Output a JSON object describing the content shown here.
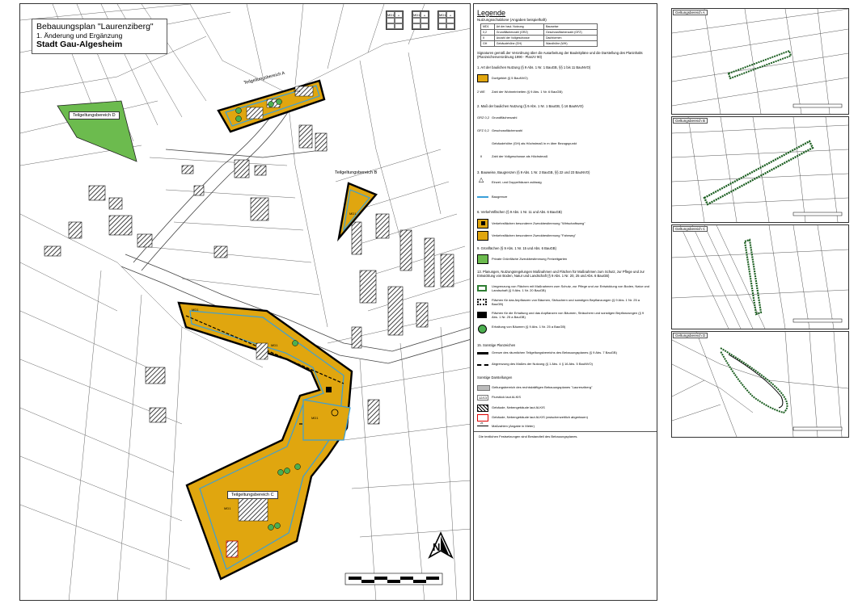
{
  "title": {
    "line1": "Bebauungsplan \"Laurenziberg\"",
    "line2": "1. Änderung und Ergänzung",
    "line3": "Stadt Gau-Algesheim"
  },
  "map": {
    "areas": {
      "a": "Teilgeltungsbereich A",
      "b": "Teilgeltungsbereich B",
      "c": "Teilgeltungsbereich C",
      "d": "Teilgeltungsbereich D"
    },
    "zone_code": "MD1",
    "north_label": "N"
  },
  "legend": {
    "heading": "Legende",
    "subheading": "Nutzungsschablone (Angaben beispielhaft)",
    "table": [
      [
        "MD1",
        "Art der baul. Nutzung",
        "Bauweise"
      ],
      [
        "0,2",
        "Grundflächenzahl (GRZ)",
        "Geschossflächenzahl (GFZ)"
      ],
      [
        "II",
        "Anzahl der Vollgeschosse",
        "Dachformen"
      ],
      [
        "GH",
        "Gebäudehöhe (GH)",
        "Wandhöhe (WH)"
      ]
    ],
    "intro": "Signaturen gemäß der Verordnung über die Ausarbeitung der Bauleitpläne und die Darstellung des Planinhalts (Planzeichenverordnung 1990 - PlanzV 90)",
    "sections": [
      {
        "title": "1.  Art der baulichen Nutzung (§ 9 Abs. 1 Nr. 1 BauGB, §§ 1 bis 11 BauNVO)",
        "items": [
          "Dorfgebiet (§ 5 BauNVO)",
          "Zahl der Wohneinheiten (§ 9 Abs. 1 Nr. 6 BauGB)"
        ]
      },
      {
        "title": "2.  Maß der baulichen Nutzung (§ 9 Abs. 1 Nr. 1 BauGB, § 16 BauNVO)",
        "items": [
          "Grundflächenzahl",
          "Geschossflächenzahl",
          "Gebäudehöhe (GH) als Höchstmaß in m über Bezugspunkt",
          "Zahl der Vollgeschosse als Höchstmaß"
        ]
      },
      {
        "title": "3.  Bauweise, Baugrenzen (§ 9 Abs. 1 Nr. 2 BauGB, §§ 22 und 23 BauNVO)",
        "items": [
          "Einzel- und Doppelhäuser zulässig",
          "Baugrenze"
        ]
      },
      {
        "title": "6.  Verkehrsflächen (§ 9 Abs. 1 Nr. 11 und Abs. 6 BauGB)",
        "items": [
          "Verkehrsflächen besonderer Zweckbestimmung \"Wirtschaftsweg\"",
          "Verkehrsflächen besonderer Zweckbestimmung \"Fahrweg\""
        ]
      },
      {
        "title": "9.  Grünflächen (§ 9 Abs. 1 Nr. 15 und Abs. 6 BauGB)",
        "items": [
          "Private Grünfläche Zweckbestimmung Freizeitgarten"
        ]
      },
      {
        "title": "13.  Planungen, Nutzungsregelungen Maßnahmen und Flächen für Maßnahmen zum Schutz, zur Pflege und zur Entwicklung von Boden, Natur und Landschaft (§ 9 Abs. 1 Nr. 20, 25 und Abs. 6 BauGB)",
        "items": [
          "Umgrenzung von Flächen mit Maßnahmen zum Schutz, zur Pflege und zur Entwicklung von Boden, Natur und Landschaft (§ 9 Abs. 1 Nr. 20 BauGB)",
          "Flächen für das Anpflanzen von Bäumen, Sträuchern und sonstigen Bepflanzungen (§ 9 Abs. 1 Nr. 25 a BauGB)",
          "Flächen für die Erhaltung und das Anpflanzen von Bäumen, Sträuchern und sonstigen Bepflanzungen (§ 9 Abs. 1 Nr. 25 a BauGB)",
          "Erhaltung von Bäumen (§ 9 Abs. 1 Nr. 25 a BauGB)"
        ]
      },
      {
        "title": "15.  Sonstige Planzeichen",
        "items": [
          "Grenze des räumlichen Teilgeltungsbereichs des Bebauungsplanes (§ 9 Abs. 7 BauGB)",
          "Abgrenzung des Maßes der Nutzung (§ 1 Abs. 4 § 16 Abs. 5 BauNVO)"
        ]
      },
      {
        "title": "Sonstige Darstellungen",
        "items": [
          "Geltungsbereich des rechtskräftigen Bebauungsplanes \"Laurenziberg\"",
          "Flurstück laut ALKIS",
          "Gebäude, Nebengebäude laut ALKIS",
          "Gebäude, Nebengebäude laut ALKIS (zwischenzeitlich abgerissen)",
          "Maßzahlen (Angabe in Meter)"
        ]
      }
    ],
    "footnote": "Die textlichen Festsetzungen sind Bestandteil des Bebauungsplanes.",
    "symbols": {
      "wohneinheiten": "2 WE",
      "grz": "GRZ 0,2",
      "gfz": "GFZ 0,2",
      "vollgeschosse": "II",
      "flurstueck": "12/13",
      "masszahl": "25"
    }
  },
  "insets": [
    {
      "tag": "Geltungsbereich A"
    },
    {
      "tag": "Geltungsbereich B"
    },
    {
      "tag": "Geltungsbereich C"
    },
    {
      "tag": "Geltungsbereich D"
    }
  ],
  "colors": {
    "dorfgebiet": "#e0a60f",
    "baugrenze": "#3a9fd8",
    "gruenflaeche": "#6cbb4e",
    "boundary": "#000000",
    "fahrweg": "#e0a60f"
  }
}
